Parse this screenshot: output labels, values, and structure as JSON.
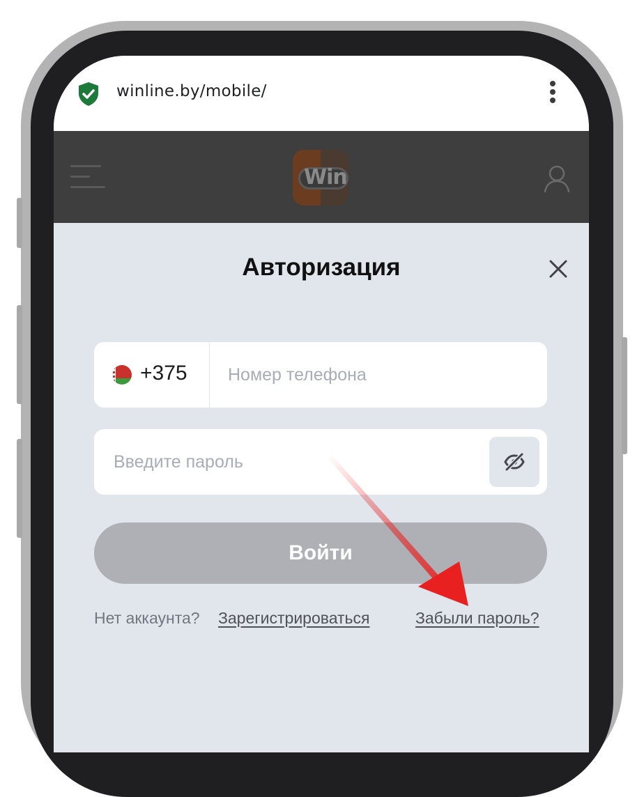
{
  "browser": {
    "url": "winline.by/mobile/",
    "secure_icon": "shield-check-icon",
    "menu_icon": "vertical-dots-icon"
  },
  "site_header": {
    "menu_icon": "hamburger-icon",
    "logo_text": "Win",
    "profile_icon": "user-icon"
  },
  "modal": {
    "title": "Авторизация",
    "close_icon": "close-icon",
    "phone": {
      "country_flag": "belarus-flag-icon",
      "country_code": "+375",
      "placeholder": "Номер телефона",
      "value": ""
    },
    "password": {
      "placeholder": "Введите пароль",
      "value": "",
      "toggle_icon": "eye-off-icon"
    },
    "login_label": "Войти",
    "no_account_text": "Нет аккаунта?",
    "register_link": "Зарегистрироваться",
    "forgot_link": "Забыли пароль?"
  },
  "colors": {
    "modal_background": "#e1e6ed",
    "header_background": "#3e3e3e",
    "button_disabled": "#afb0b6",
    "secure_green": "#1e7a3a",
    "annotation_arrow": "#e8201f"
  }
}
